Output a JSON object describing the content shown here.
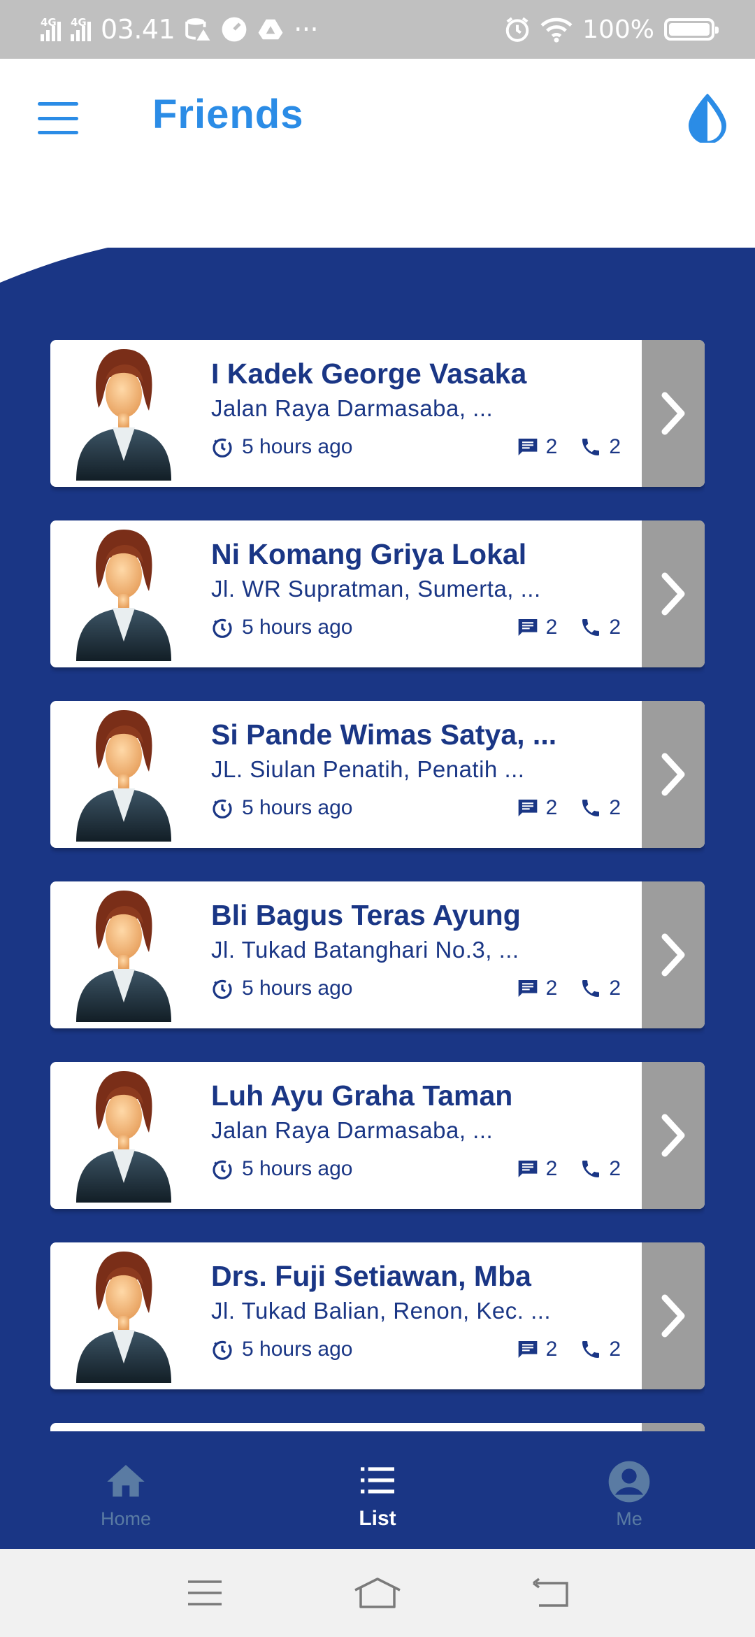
{
  "status_bar": {
    "network_1": "4G",
    "network_2": "4G",
    "time": "03.41",
    "extra": "···",
    "battery_text": "100%"
  },
  "header": {
    "title": "Friends",
    "menu_icon": "hamburger-menu-icon",
    "action_icon": "water-drop-icon"
  },
  "colors": {
    "primary": "#1a3685",
    "accent": "#2b8ce6",
    "arrow_bg": "#9d9d9d",
    "status_bar": "#c0c0c0"
  },
  "friends": [
    {
      "name": "I Kadek George Vasaka",
      "address": "Jalan Raya Darmasaba, ...",
      "time": "5 hours ago",
      "messages": "2",
      "calls": "2"
    },
    {
      "name": "Ni Komang Griya Lokal",
      "address": "Jl. WR Supratman, Sumerta, ...",
      "time": "5 hours ago",
      "messages": "2",
      "calls": "2"
    },
    {
      "name": "Si Pande Wimas Satya, ...",
      "address": "JL. Siulan Penatih, Penatih ...",
      "time": "5 hours ago",
      "messages": "2",
      "calls": "2"
    },
    {
      "name": "Bli Bagus Teras Ayung",
      "address": "Jl. Tukad Batanghari No.3, ...",
      "time": "5 hours ago",
      "messages": "2",
      "calls": "2"
    },
    {
      "name": "Luh Ayu Graha Taman",
      "address": "Jalan Raya Darmasaba, ...",
      "time": "5 hours ago",
      "messages": "2",
      "calls": "2"
    },
    {
      "name": "Drs. Fuji Setiawan, Mba",
      "address": "Jl. Tukad Balian, Renon, Kec. ...",
      "time": "5 hours ago",
      "messages": "2",
      "calls": "2"
    },
    {
      "name": "",
      "address": "",
      "time": "",
      "messages": "",
      "calls": ""
    }
  ],
  "bottom_nav": {
    "home": "Home",
    "list": "List",
    "me": "Me",
    "active": "list"
  }
}
